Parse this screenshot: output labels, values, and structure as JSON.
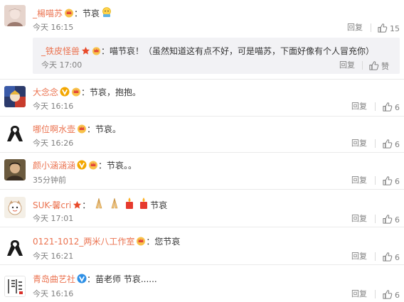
{
  "comments": [
    {
      "user": "_楊喵苏",
      "text": "：节哀",
      "time": "今天 16:15",
      "reply": "回复",
      "likes": "15"
    },
    {
      "user": "大念念",
      "text": "：节哀，抱抱。",
      "time": "今天 16:16",
      "reply": "回复",
      "likes": "6"
    },
    {
      "user": "哪位啊水壶",
      "text": "：节哀。",
      "time": "今天 16:26",
      "reply": "回复",
      "likes": "6"
    },
    {
      "user": "颜小涵涵涵",
      "text": "：节哀。。",
      "time": "35分钟前",
      "reply": "回复",
      "likes": "6"
    },
    {
      "user": "SUK-馨cri",
      "text": "节哀",
      "time": "今天 17:01",
      "reply": "回复",
      "likes": "6"
    },
    {
      "user": "0121-1012_两米八工作室",
      "text": "：您节哀",
      "time": "今天 16:21",
      "reply": "回复",
      "likes": "6"
    },
    {
      "user": "青岛曲艺社",
      "text": "：苗老师  节哀......",
      "time": "今天 16:16",
      "reply": "回复",
      "likes": "6"
    }
  ],
  "subreply": {
    "user": "_铁皮怪兽",
    "text": "：喵节哀！（虽然知道这有点不好，可是喵苏，下面好像有个人冒充你）",
    "time": "今天 17:00",
    "reply": "回复",
    "like_label": "赞"
  },
  "colors": {
    "username": "#eb7350",
    "time": "#808080",
    "subreply_bg": "#f2f2f5"
  },
  "icons": {
    "like": "thumbs-up-icon",
    "verified": "verified-v-icon",
    "vip": "crown-icon"
  }
}
